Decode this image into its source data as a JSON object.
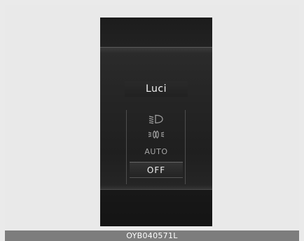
{
  "screen": {
    "title": "Luci",
    "options": [
      {
        "icon": "low-beam-headlight-icon"
      },
      {
        "icon": "position-light-icon"
      },
      {
        "label": "AUTO"
      },
      {
        "label": "OFF",
        "selected": true
      }
    ]
  },
  "caption": "OYB040571L",
  "colors": {
    "page_bg": "#eaeaea",
    "display_bg": "#1a1a1a",
    "caption_bar": "#7d7d7d"
  }
}
